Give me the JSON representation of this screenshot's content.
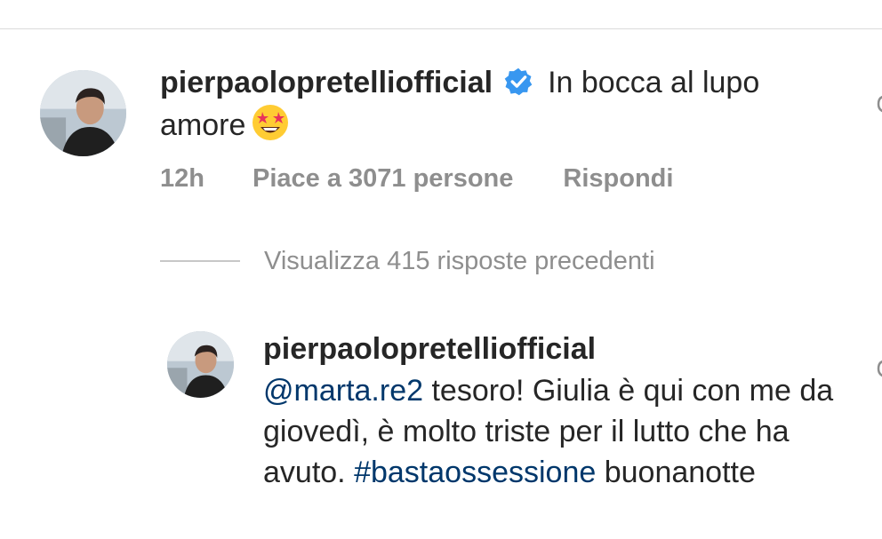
{
  "comment": {
    "username": "pierpaolopretelliofficial",
    "verified": true,
    "text_line1": "In bocca al lupo",
    "text_line2": "amore",
    "emoji": "star-struck-emoji",
    "time": "12h",
    "likes": "Piace a 3071 persone",
    "reply_label": "Rispondi"
  },
  "view_replies": {
    "label": "Visualizza 415 risposte precedenti"
  },
  "reply": {
    "username": "pierpaolopretelliofficial",
    "mention": "@marta.re2",
    "text_a": " tesoro! Giulia è qui con me da giovedì, è molto triste per il lutto che ha avuto. ",
    "hashtag": "#bastaossessione",
    "text_b": " buonanotte"
  },
  "colors": {
    "text": "#262626",
    "meta": "#8e8e8e",
    "link": "#00376b",
    "verified": "#3897f0"
  },
  "icons": {
    "verified": "verified-badge-icon",
    "like": "heart-icon"
  }
}
